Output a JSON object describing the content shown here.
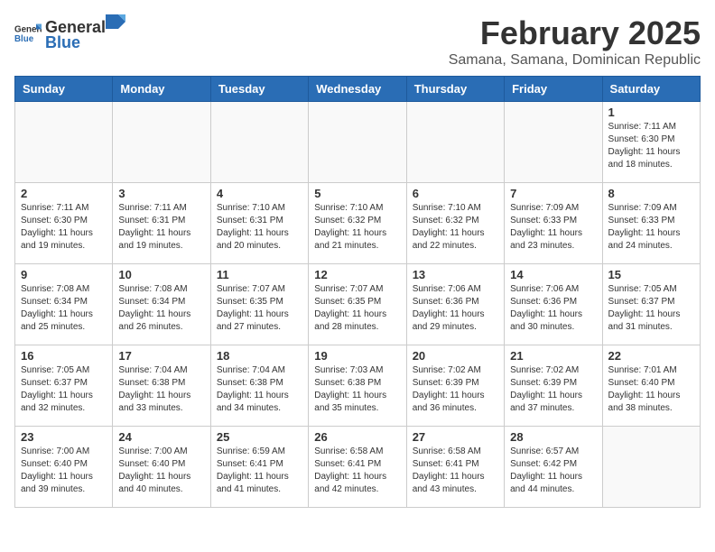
{
  "header": {
    "logo_general": "General",
    "logo_blue": "Blue",
    "title": "February 2025",
    "subtitle": "Samana, Samana, Dominican Republic"
  },
  "calendar": {
    "days_of_week": [
      "Sunday",
      "Monday",
      "Tuesday",
      "Wednesday",
      "Thursday",
      "Friday",
      "Saturday"
    ],
    "weeks": [
      [
        {
          "day": "",
          "info": ""
        },
        {
          "day": "",
          "info": ""
        },
        {
          "day": "",
          "info": ""
        },
        {
          "day": "",
          "info": ""
        },
        {
          "day": "",
          "info": ""
        },
        {
          "day": "",
          "info": ""
        },
        {
          "day": "1",
          "info": "Sunrise: 7:11 AM\nSunset: 6:30 PM\nDaylight: 11 hours and 18 minutes."
        }
      ],
      [
        {
          "day": "2",
          "info": "Sunrise: 7:11 AM\nSunset: 6:30 PM\nDaylight: 11 hours and 19 minutes."
        },
        {
          "day": "3",
          "info": "Sunrise: 7:11 AM\nSunset: 6:31 PM\nDaylight: 11 hours and 19 minutes."
        },
        {
          "day": "4",
          "info": "Sunrise: 7:10 AM\nSunset: 6:31 PM\nDaylight: 11 hours and 20 minutes."
        },
        {
          "day": "5",
          "info": "Sunrise: 7:10 AM\nSunset: 6:32 PM\nDaylight: 11 hours and 21 minutes."
        },
        {
          "day": "6",
          "info": "Sunrise: 7:10 AM\nSunset: 6:32 PM\nDaylight: 11 hours and 22 minutes."
        },
        {
          "day": "7",
          "info": "Sunrise: 7:09 AM\nSunset: 6:33 PM\nDaylight: 11 hours and 23 minutes."
        },
        {
          "day": "8",
          "info": "Sunrise: 7:09 AM\nSunset: 6:33 PM\nDaylight: 11 hours and 24 minutes."
        }
      ],
      [
        {
          "day": "9",
          "info": "Sunrise: 7:08 AM\nSunset: 6:34 PM\nDaylight: 11 hours and 25 minutes."
        },
        {
          "day": "10",
          "info": "Sunrise: 7:08 AM\nSunset: 6:34 PM\nDaylight: 11 hours and 26 minutes."
        },
        {
          "day": "11",
          "info": "Sunrise: 7:07 AM\nSunset: 6:35 PM\nDaylight: 11 hours and 27 minutes."
        },
        {
          "day": "12",
          "info": "Sunrise: 7:07 AM\nSunset: 6:35 PM\nDaylight: 11 hours and 28 minutes."
        },
        {
          "day": "13",
          "info": "Sunrise: 7:06 AM\nSunset: 6:36 PM\nDaylight: 11 hours and 29 minutes."
        },
        {
          "day": "14",
          "info": "Sunrise: 7:06 AM\nSunset: 6:36 PM\nDaylight: 11 hours and 30 minutes."
        },
        {
          "day": "15",
          "info": "Sunrise: 7:05 AM\nSunset: 6:37 PM\nDaylight: 11 hours and 31 minutes."
        }
      ],
      [
        {
          "day": "16",
          "info": "Sunrise: 7:05 AM\nSunset: 6:37 PM\nDaylight: 11 hours and 32 minutes."
        },
        {
          "day": "17",
          "info": "Sunrise: 7:04 AM\nSunset: 6:38 PM\nDaylight: 11 hours and 33 minutes."
        },
        {
          "day": "18",
          "info": "Sunrise: 7:04 AM\nSunset: 6:38 PM\nDaylight: 11 hours and 34 minutes."
        },
        {
          "day": "19",
          "info": "Sunrise: 7:03 AM\nSunset: 6:38 PM\nDaylight: 11 hours and 35 minutes."
        },
        {
          "day": "20",
          "info": "Sunrise: 7:02 AM\nSunset: 6:39 PM\nDaylight: 11 hours and 36 minutes."
        },
        {
          "day": "21",
          "info": "Sunrise: 7:02 AM\nSunset: 6:39 PM\nDaylight: 11 hours and 37 minutes."
        },
        {
          "day": "22",
          "info": "Sunrise: 7:01 AM\nSunset: 6:40 PM\nDaylight: 11 hours and 38 minutes."
        }
      ],
      [
        {
          "day": "23",
          "info": "Sunrise: 7:00 AM\nSunset: 6:40 PM\nDaylight: 11 hours and 39 minutes."
        },
        {
          "day": "24",
          "info": "Sunrise: 7:00 AM\nSunset: 6:40 PM\nDaylight: 11 hours and 40 minutes."
        },
        {
          "day": "25",
          "info": "Sunrise: 6:59 AM\nSunset: 6:41 PM\nDaylight: 11 hours and 41 minutes."
        },
        {
          "day": "26",
          "info": "Sunrise: 6:58 AM\nSunset: 6:41 PM\nDaylight: 11 hours and 42 minutes."
        },
        {
          "day": "27",
          "info": "Sunrise: 6:58 AM\nSunset: 6:41 PM\nDaylight: 11 hours and 43 minutes."
        },
        {
          "day": "28",
          "info": "Sunrise: 6:57 AM\nSunset: 6:42 PM\nDaylight: 11 hours and 44 minutes."
        },
        {
          "day": "",
          "info": ""
        }
      ]
    ]
  }
}
